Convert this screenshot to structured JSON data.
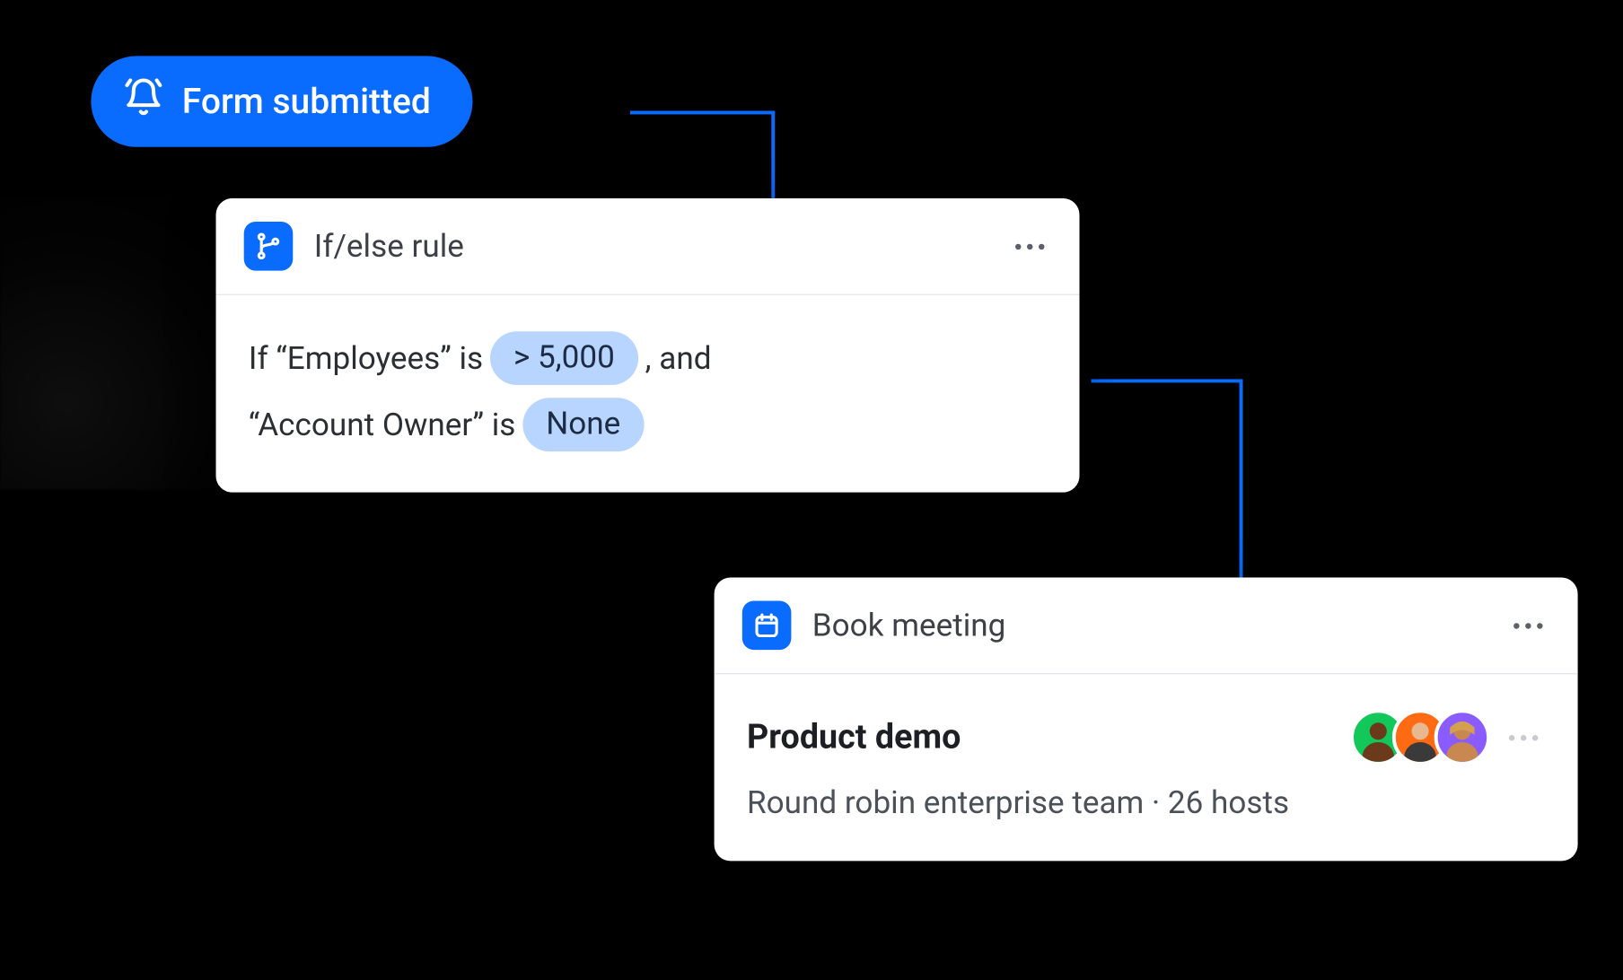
{
  "colors": {
    "primary": "#0a6cff",
    "chip_bg": "#b8d5ff",
    "avatar1": "#12c85a",
    "avatar2": "#ff6a13",
    "avatar3": "#8a5cff"
  },
  "trigger": {
    "icon": "bell-icon",
    "label": "Form submitted"
  },
  "rule_card": {
    "icon": "branch-icon",
    "title": "If/else rule",
    "condition": {
      "prefix1": "If “Employees” is",
      "value1": "> 5,000",
      "suffix1": ", and",
      "prefix2": "“Account Owner” is",
      "value2": "None"
    }
  },
  "meeting_card": {
    "icon": "calendar-icon",
    "title": "Book meeting",
    "meeting_name": "Product demo",
    "subtitle": "Round robin enterprise team · 26 hosts",
    "host_count": 26,
    "distribution": "Round robin",
    "team": "enterprise team"
  }
}
